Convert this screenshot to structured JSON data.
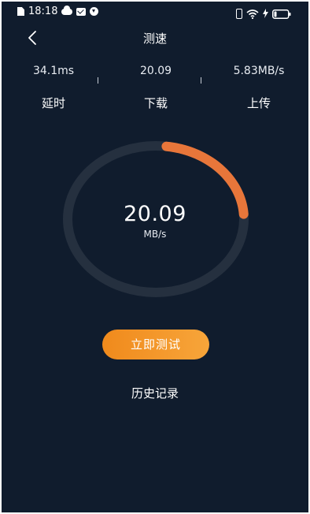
{
  "status_bar": {
    "time": "18:18",
    "left_icons": [
      "sim-icon",
      "cloud-icon",
      "mail-icon",
      "download-icon"
    ],
    "right_icons": [
      "vibrate-icon",
      "wifi-icon",
      "charging-icon",
      "battery-icon"
    ]
  },
  "header": {
    "title": "测速",
    "back_icon": "chevron-left-icon"
  },
  "stats": [
    {
      "value": "34.1ms",
      "label": "延时"
    },
    {
      "value": "20.09",
      "label": "下载"
    },
    {
      "value": "5.83MB/s",
      "label": "上传"
    }
  ],
  "gauge": {
    "value": "20.09",
    "unit": "MB/s",
    "progress_fraction": 0.22
  },
  "actions": {
    "start_label": "立即测试",
    "history_label": "历史记录"
  },
  "colors": {
    "background": "#101c2d",
    "track": "#25303f",
    "accent": "#e8763a",
    "button_start": "#f08a1c",
    "button_end": "#f7a53a"
  }
}
